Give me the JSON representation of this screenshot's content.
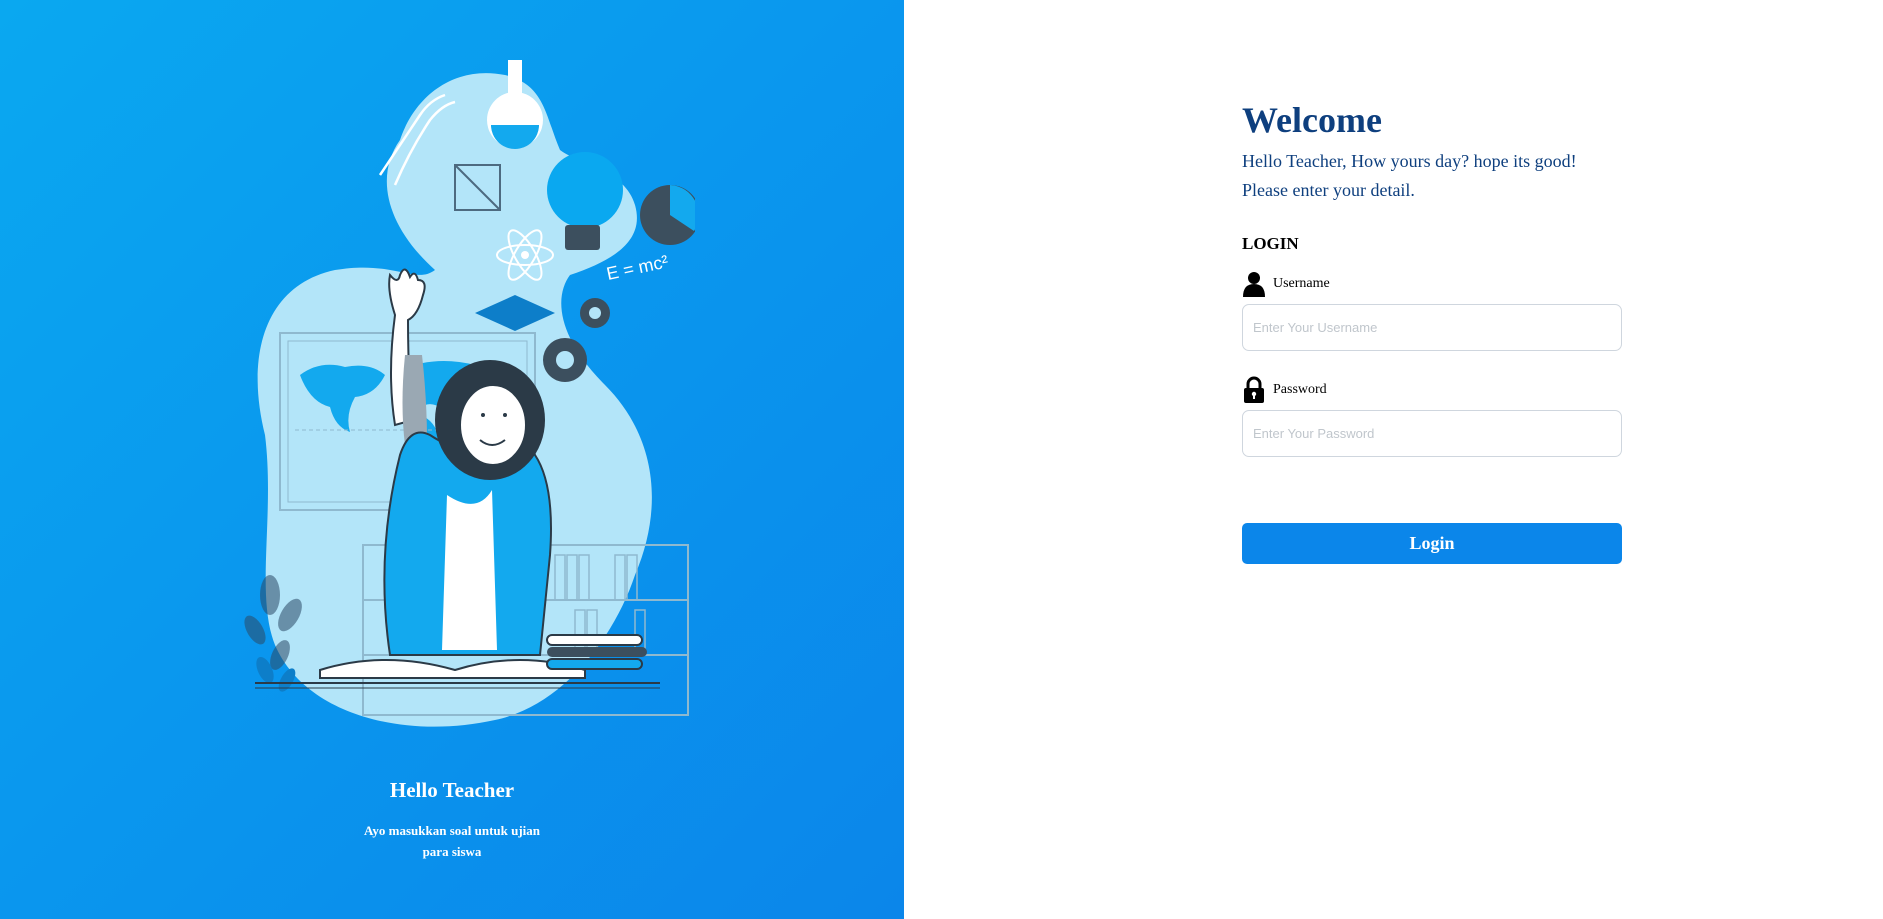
{
  "hero": {
    "title": "Hello Teacher",
    "subtitle": "Ayo masukkan soal untuk ujian para siswa",
    "illustration": "teacher-raising-hand-illustration",
    "formula": "E = mc²"
  },
  "login": {
    "welcome": "Welcome",
    "greeting_line1": "Hello Teacher, How yours day? hope its good!",
    "greeting_line2": "Please enter your detail.",
    "section_title": "LOGIN",
    "username_label": "Username",
    "username_placeholder": "Enter Your Username",
    "username_value": "",
    "password_label": "Password",
    "password_placeholder": "Enter Your Password",
    "password_value": "",
    "button_label": "Login"
  },
  "icons": {
    "username": "user-icon",
    "password": "lock-icon"
  },
  "colors": {
    "panel_gradient_start": "#0aa8f0",
    "panel_gradient_end": "#0b86ea",
    "heading": "#0e3f7e",
    "button": "#0b86ea"
  }
}
